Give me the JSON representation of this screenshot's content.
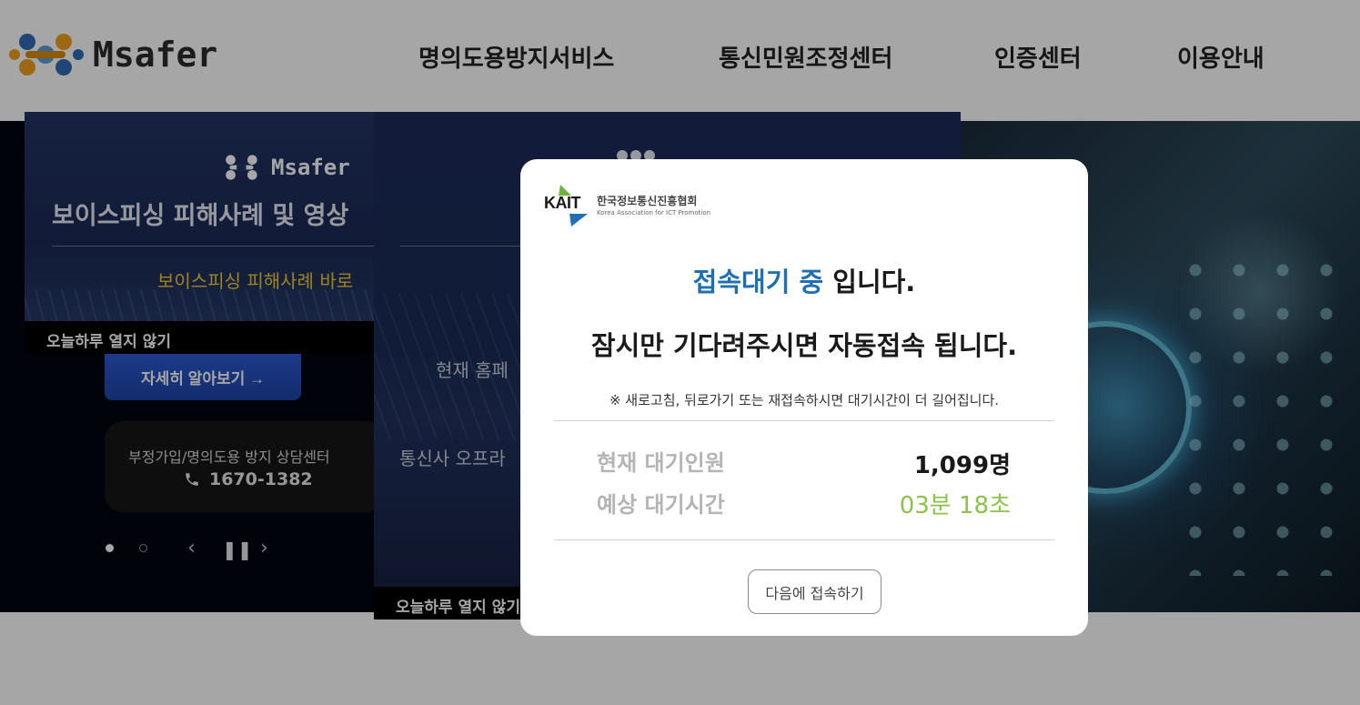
{
  "header": {
    "logo_text": "Msafer",
    "nav": [
      {
        "label": "명의도용방지서비스"
      },
      {
        "label": "통신민원조정센터"
      },
      {
        "label": "인증센터"
      },
      {
        "label": "이용안내"
      }
    ]
  },
  "popup1": {
    "logo_text": "Msafer",
    "title": "보이스피싱 피해사례 및 영상",
    "subtitle": "보이스피싱 피해사례 바로",
    "dismiss_label": "오늘하루 열지 않기",
    "detail_button": "자세히 알아보기 →",
    "center": {
      "label": "부정가입/명의도용 방지 상담센터",
      "phone": "1670-1382"
    }
  },
  "slider": {
    "prev_icon": "chevron-left-icon",
    "pause_icon": "pause-icon",
    "next_icon": "chevron-right-icon",
    "active_dot": "#ffffff",
    "inactive_dot": "#888888"
  },
  "popup2": {
    "text1": "현재 홈페",
    "text2": "통신사 오프라",
    "dismiss_label": "오늘하루 열지 않기"
  },
  "modal": {
    "org_logo": "KAIT",
    "org_name_kr": "한국정보통신진흥협회",
    "org_name_en": "Korea Association for ICT Promotion",
    "status_highlight": "접속대기 중",
    "status_rest": " 입니다.",
    "wait_message": "잠시만 기다려주시면 자동접속 됩니다.",
    "note": "※ 새로고침, 뒤로가기 또는 재접속하시면 대기시간이 더 길어집니다.",
    "queue_label": "현재 대기인원",
    "queue_value": "1,099명",
    "eta_label": "예상 대기시간",
    "eta_value": "03분 18초",
    "later_button": "다음에 접속하기",
    "highlight_color": "#1f6fb2",
    "eta_color": "#8bc34a"
  }
}
